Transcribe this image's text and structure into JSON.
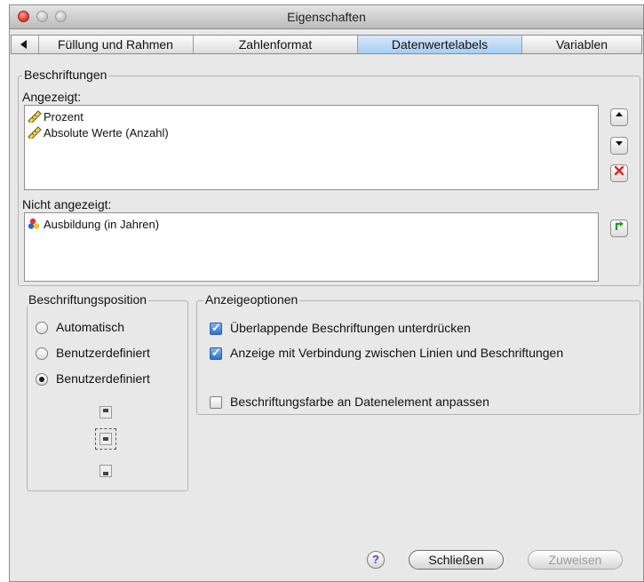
{
  "window": {
    "title": "Eigenschaften"
  },
  "tabs": [
    {
      "label": "Füllung und Rahmen"
    },
    {
      "label": "Zahlenformat"
    },
    {
      "label": "Datenwertelabels",
      "active": true
    },
    {
      "label": "Variablen"
    }
  ],
  "beschriftungen": {
    "group_label": "Beschriftungen",
    "shown_label": "Angezeigt:",
    "shown_items": [
      {
        "label": "Prozent",
        "icon": "ruler-icon"
      },
      {
        "label": "Absolute Werte (Anzahl)",
        "icon": "ruler-icon"
      }
    ],
    "hidden_label": "Nicht angezeigt:",
    "hidden_items": [
      {
        "label": "Ausbildung (in Jahren)",
        "icon": "variable-circles-icon"
      }
    ],
    "side_buttons": {
      "up": "move-up-icon",
      "down": "move-down-icon",
      "remove": "remove-icon",
      "add": "add-icon"
    }
  },
  "position": {
    "group_label": "Beschriftungsposition",
    "options": [
      {
        "label": "Automatisch",
        "selected": false
      },
      {
        "label": "Benutzerdefiniert",
        "selected": false
      },
      {
        "label": "Benutzerdefiniert",
        "selected": true
      }
    ],
    "position_icons": [
      "label-position-top-icon",
      "label-position-middle-icon",
      "label-position-bottom-icon"
    ]
  },
  "anzeige": {
    "group_label": "Anzeigeoptionen",
    "options": [
      {
        "label": "Überlappende Beschriftungen unterdrücken",
        "checked": true
      },
      {
        "label": "Anzeige mit Verbindung zwischen Linien und Beschriftungen",
        "checked": true
      },
      {
        "label": "Beschriftungsfarbe an Datenelement anpassen",
        "checked": false
      }
    ]
  },
  "footer": {
    "help_label": "?",
    "close_label": "Schließen",
    "apply_label": "Zuweisen"
  },
  "colors": {
    "active_tab": "#a8cdf3",
    "help_accent": "#6a2ed1",
    "remove_red": "#e0251b",
    "add_green": "#1f9a1f"
  }
}
